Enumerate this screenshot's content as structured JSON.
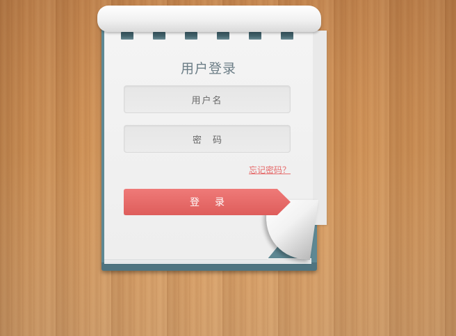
{
  "login": {
    "title": "用户登录",
    "username_placeholder": "用户名",
    "password_placeholder": "密码",
    "forgot_label": "忘记密码？",
    "submit_label": "登录"
  },
  "colors": {
    "accent": "#e06462",
    "cover": "#5e8893",
    "wood": "#cf925a"
  }
}
